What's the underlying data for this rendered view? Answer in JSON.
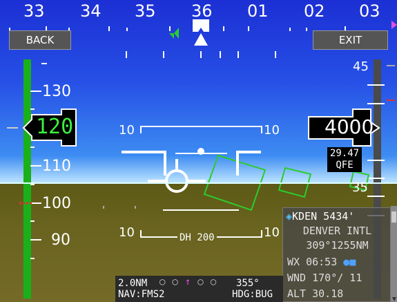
{
  "heading_tape": [
    "33",
    "34",
    "35",
    "36",
    "01",
    "02",
    "03"
  ],
  "buttons": {
    "back": "BACK",
    "exit": "EXIT"
  },
  "speed_tape": [
    "130",
    "110",
    "100",
    "90"
  ],
  "airspeed": {
    "value": "120"
  },
  "altitude_tape": [
    "45",
    "35"
  ],
  "altitude": {
    "value": "4000"
  },
  "baro": {
    "value": "29.47",
    "mode": "QFE"
  },
  "pitch_ladder": [
    "10",
    "10"
  ],
  "decision_height": "DH 200",
  "airport": {
    "id_elev": "KDEN 5434'",
    "name": "DENVER INTL",
    "bearing_dist": "309°1255NM",
    "wx_label": "WX",
    "wx_time": "06:53",
    "wind_label": "WND",
    "wind_value": "170°/ 11",
    "alt_label": "ALT",
    "alt_value": "30.18"
  },
  "nav": {
    "distance": "2.0NM",
    "hdg_value": "355°",
    "source": "NAV:FMS2",
    "hdg_mode": "HDG:BUG"
  },
  "colors": {
    "sky": "#2650e6",
    "ground": "#6a6420",
    "speed_readout": "#3df03d",
    "speed_band": "#1ab01a",
    "pathway": "#2ccb2c",
    "course_pointer": "#e050e0"
  }
}
